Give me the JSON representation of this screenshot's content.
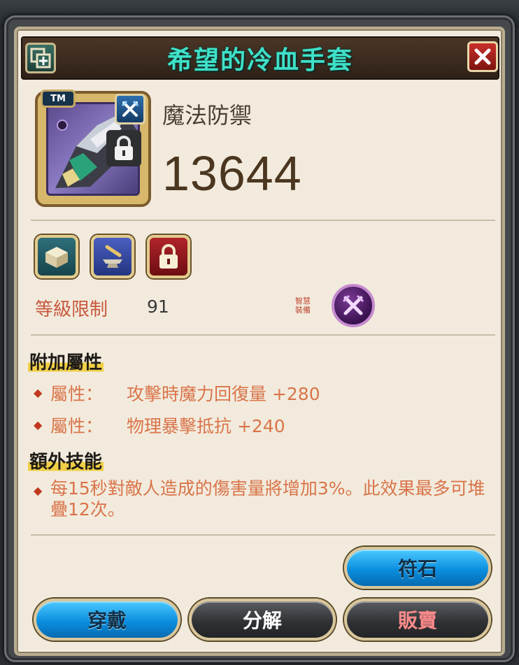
{
  "title": "希望的冷血手套",
  "item": {
    "badge": "TM",
    "stat_label": "魔法防禦",
    "stat_value": "13644"
  },
  "level": {
    "label": "等級限制",
    "value": "91",
    "tiny_note": "智慧\n裝備"
  },
  "additional_attributes": {
    "heading": "附加屬性",
    "items": [
      {
        "label": "屬性：",
        "text": "攻擊時魔力回復量",
        "value": "+280"
      },
      {
        "label": "屬性：",
        "text": "物理暴擊抵抗",
        "value": "+240"
      }
    ]
  },
  "extra_skill": {
    "heading": "額外技能",
    "text": "每15秒對敵人造成的傷害量將增加3%。此效果最多可堆疊12次。"
  },
  "buttons": {
    "rune": "符石",
    "equip": "穿戴",
    "disassemble": "分解",
    "sell": "販賣"
  },
  "colors": {
    "title": "#3fe0c8",
    "attribute_text": "#d9744a",
    "level_label": "#c8583c",
    "button_blue": "#0b8fe0"
  },
  "icons": [
    "expand-icon",
    "close-icon",
    "class-icon",
    "lock-icon",
    "anvil-box-icon",
    "smithing-icon",
    "padlock-icon",
    "crossed-swords-icon"
  ]
}
